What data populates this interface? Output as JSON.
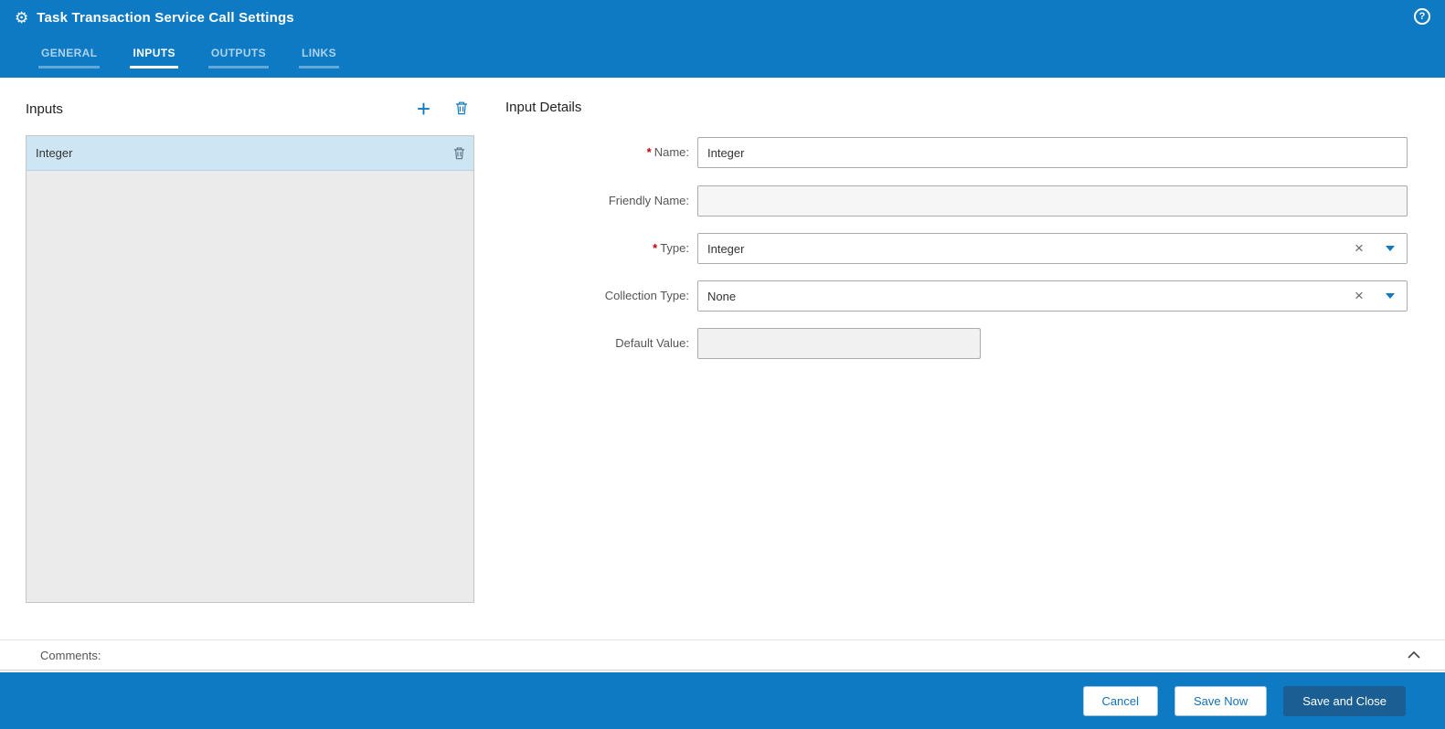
{
  "header": {
    "title": "Task Transaction Service Call Settings",
    "tabs": [
      {
        "label": "GENERAL",
        "active": false
      },
      {
        "label": "INPUTS",
        "active": true
      },
      {
        "label": "OUTPUTS",
        "active": false
      },
      {
        "label": "LINKS",
        "active": false
      }
    ]
  },
  "inputs_panel": {
    "title": "Inputs",
    "items": [
      {
        "label": "Integer",
        "selected": true
      }
    ]
  },
  "details_panel": {
    "title": "Input Details",
    "fields": {
      "name": {
        "label": "Name:",
        "required": true,
        "value": "Integer"
      },
      "friendly_name": {
        "label": "Friendly Name:",
        "required": false,
        "value": ""
      },
      "type": {
        "label": "Type:",
        "required": true,
        "value": "Integer"
      },
      "collection_type": {
        "label": "Collection Type:",
        "required": false,
        "value": "None"
      },
      "default_value": {
        "label": "Default Value:",
        "required": false,
        "value": ""
      }
    }
  },
  "comments": {
    "label": "Comments:"
  },
  "footer": {
    "buttons": [
      {
        "label": "Cancel",
        "primary": false
      },
      {
        "label": "Save Now",
        "primary": false
      },
      {
        "label": "Save and Close",
        "primary": true
      }
    ]
  },
  "ui": {
    "required_marker": "*"
  },
  "icons": {
    "gear": "⚙",
    "help": "?",
    "add": "+",
    "delete": "trash",
    "clear": "×",
    "dropdown": "caret-down",
    "collapse": "chevron-up"
  },
  "colors": {
    "header_blue": "#0e7ac4",
    "primary_button_blue": "#1b5e93",
    "accent_blue": "#1079c1",
    "selected_row_blue": "#cee5f4",
    "required_red": "#c00202",
    "list_background": "#ebebeb"
  }
}
